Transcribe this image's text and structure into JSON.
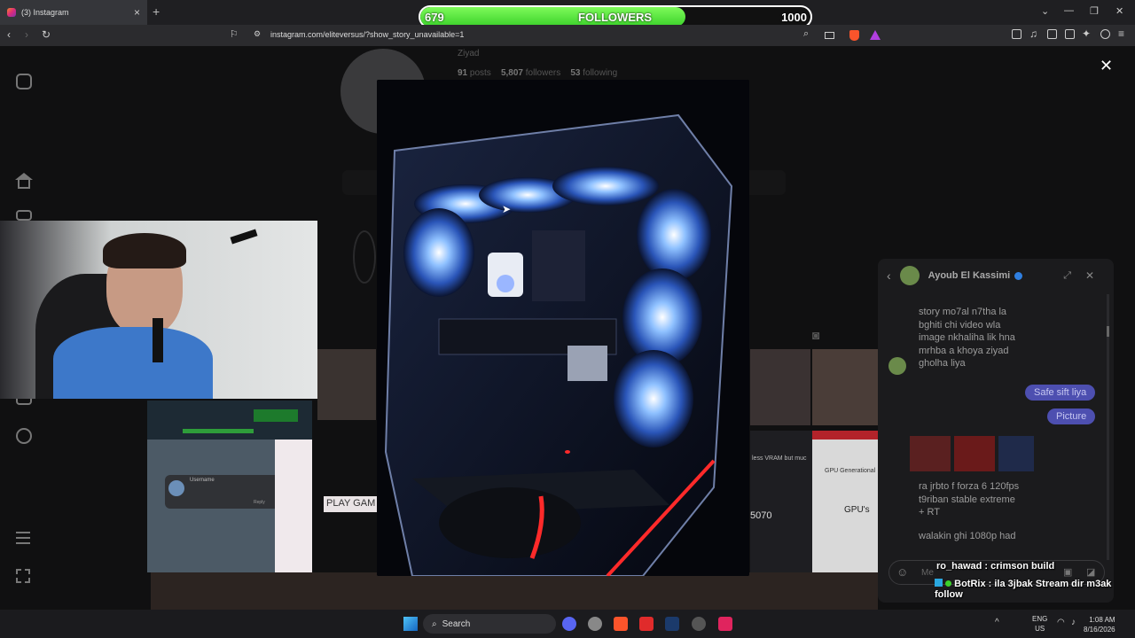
{
  "browser": {
    "tab_title": "(3) Instagram",
    "new_tab_symbol": "+",
    "url": "instagram.com/eliteversus/?show_story_unavailable=1"
  },
  "followers_goal": {
    "current": "679",
    "label": "FOLLOWERS",
    "goal": "1000",
    "progress": 0.679
  },
  "profile": {
    "name": "Ziyad",
    "posts_count": "91",
    "posts_label": "posts",
    "followers_count": "5,807",
    "followers_label": "followers",
    "following_count": "53",
    "following_label": "following"
  },
  "background_thumbs": {
    "comment_username": "Username",
    "comment_reply": "Reply",
    "play_text": "PLAY GAM",
    "vram_text": "less VRAM but muc",
    "gpu_title": "GPU Generational",
    "gpu_short": "GPU's",
    "price": "5070"
  },
  "chat": {
    "contact_name": "Ayoub El Kassimi",
    "messages_in_1": [
      "story mo7al n7tha la",
      "bghiti chi video wla",
      "image nkhaliha lik hna",
      "mrhba a khoya ziyad",
      "gholha liya"
    ],
    "messages_out": [
      "Safe sift liya",
      "Picture"
    ],
    "messages_in_2": [
      "ra jrbto f forza 6 120fps",
      "t9riban stable extreme",
      "+ RT"
    ],
    "messages_in_3": "walakin ghi 1080p had",
    "input_placeholder": "Me"
  },
  "stream_overlay": {
    "line1_user": "ro_hawad",
    "line1_text": ": crimson build",
    "line2_user": "BotRix",
    "line2_text": ": ila 3jbak Stream dir m3ak follow"
  },
  "taskbar": {
    "search_label": "Search",
    "lang_top": "ENG",
    "lang_bottom": "US",
    "time": "1:08 AM",
    "date": "8/16/2026"
  },
  "colors": {
    "accent_green": "#3bd12a",
    "chat_out_bubble": "#4d4fb0",
    "fan_glow": "#7fb6ff",
    "rgb_red": "#ff2a2a"
  }
}
